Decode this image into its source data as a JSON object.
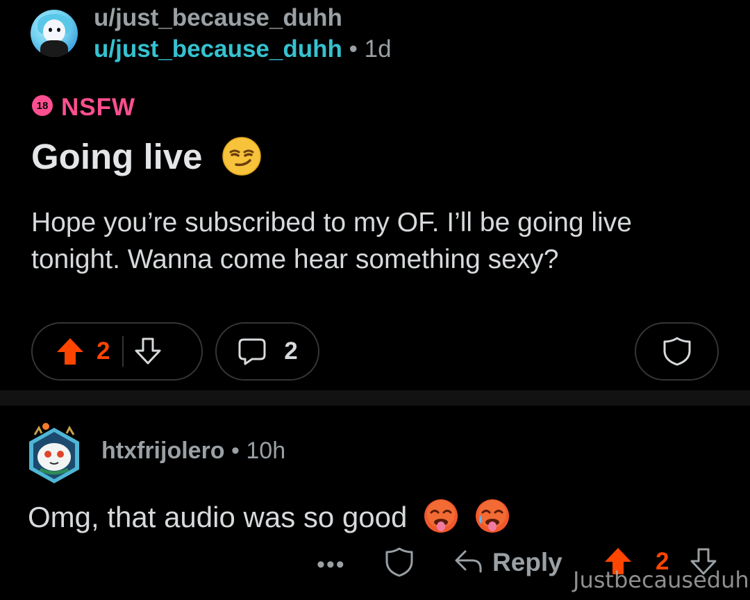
{
  "post": {
    "author_top": "u/just_because_duhh",
    "author": "u/just_because_duhh",
    "separator": "•",
    "age": "1d",
    "nsfw_badge": "18",
    "nsfw_label": "NSFW",
    "title": "Going live",
    "title_emoji": "smirking-face",
    "body": "Hope you’re subscribed to my OF. I’ll be going live tonight. Wanna come hear something sexy?",
    "upvotes": "2",
    "comments": "2"
  },
  "comment": {
    "author": "htxfrijolero",
    "separator": "•",
    "age": "10h",
    "text": "Omg, that audio was so good",
    "emojis": [
      "hot-face",
      "hot-face-sweat"
    ],
    "more": "•••",
    "reply_label": "Reply",
    "upvotes": "2"
  },
  "watermark": "Justbecauseduh",
  "colors": {
    "background": "#000000",
    "accent_upvote": "#ff4500",
    "nsfw_pink": "#ff4f90",
    "username_teal": "#35c2d0",
    "muted_text": "#9aa0a4"
  }
}
